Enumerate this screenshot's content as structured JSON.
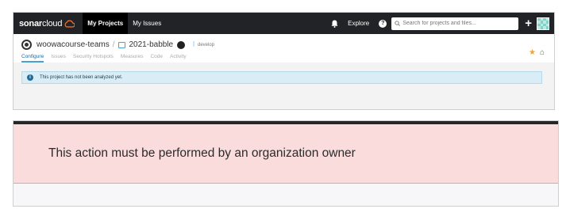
{
  "topbar": {
    "logo_text_bold": "sonar",
    "logo_text": "cloud",
    "nav": [
      "My Projects",
      "My Issues"
    ],
    "explore_label": "Explore",
    "search_placeholder": "Search for projects and files...",
    "plus_label": "+"
  },
  "project": {
    "org_name": "woowacourse-teams",
    "separator": "/",
    "project_name": "2021-babble",
    "branch_name": "develop",
    "tabs": [
      "Configure",
      "Issues",
      "Security Hotspots",
      "Measures",
      "Code",
      "Activity"
    ]
  },
  "alert": {
    "message": "This project has not been analyzed yet."
  },
  "error": {
    "message": "This action must be performed by an organization owner"
  },
  "colors": {
    "topbar_bg": "#222326",
    "logo_accent": "#f6752a",
    "tab_active": "#236a97",
    "alert_bg": "#d9edf7",
    "error_bg": "#f9dcdb",
    "star": "#f4a22d"
  }
}
